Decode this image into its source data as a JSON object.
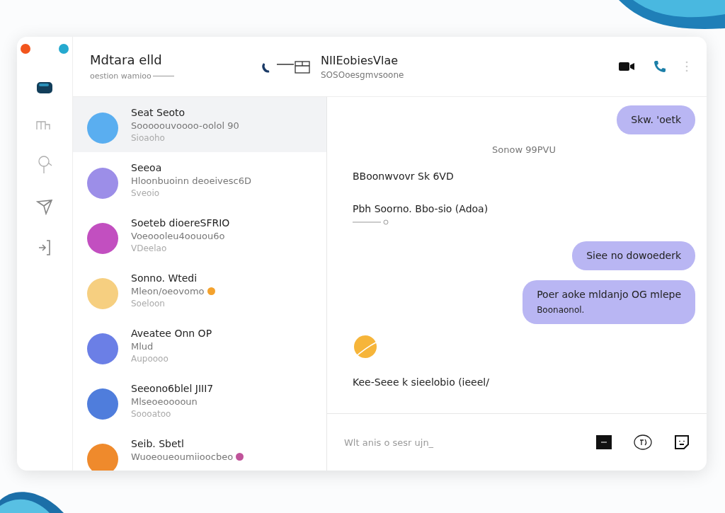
{
  "window": {
    "controls": [
      {
        "color": "#f2551d"
      },
      {
        "color": "#25a9cf"
      }
    ]
  },
  "rail": {
    "items": [
      {
        "selected": true
      },
      {
        "selected": false
      },
      {
        "selected": false
      },
      {
        "selected": false
      },
      {
        "selected": false
      }
    ]
  },
  "header": {
    "title": "Mdtara elld",
    "subtitle": "oestion wamioo",
    "contact_name": "NIIEobiesVlae",
    "contact_status": "SOSOoesgmvsoone"
  },
  "chats": [
    {
      "name": "Seat Seoto",
      "preview": "Sooooouvoooo-oolol 90",
      "time": "Sioaoho",
      "selected": true,
      "unread": false
    },
    {
      "name": "Seeoa",
      "preview": "Hloonbuoinn deoeivesc6D",
      "time": "Sveoio",
      "selected": false,
      "unread": false
    },
    {
      "name": "Soeteb dioereSFRIO",
      "preview": "Voeoooleu4oouou6o",
      "time": "VDeelao",
      "selected": false,
      "unread": false
    },
    {
      "name": "Sonno. Wtedi",
      "preview": "Mleon/oeovomo",
      "time": "Soeloon",
      "selected": false,
      "unread": true
    },
    {
      "name": "Aveatee Onn OP",
      "preview": "Mlud",
      "time": "Aupoooo",
      "selected": false,
      "unread": false
    },
    {
      "name": "Seeono6blel JIII7",
      "preview": "Mlseoeooooun",
      "time": "Soooatoo",
      "selected": false,
      "unread": false
    },
    {
      "name": "Seib. Sbetl",
      "preview": "Wuoeoueoumiioocbeo",
      "selected": false,
      "unread": true
    }
  ],
  "messages": [
    {
      "kind": "outgoing",
      "text": "Skw. 'oetk"
    },
    {
      "kind": "date",
      "text": "Sonow 99PVU"
    },
    {
      "kind": "incoming",
      "text": "BBoonwvovr Sk 6VD"
    },
    {
      "kind": "incoming",
      "text": "Pbh Soorno. Bbo-sio (Adoa)",
      "marker": true
    },
    {
      "kind": "outgoing",
      "text": "Siee no dowoederk"
    },
    {
      "kind": "outgoing",
      "text": "Poer aoke mldanjo OG mlepe",
      "second_line": "Boonaonol."
    },
    {
      "kind": "sticker"
    },
    {
      "kind": "incoming",
      "text": "Kee-Seee k sieelobio (ieeel/"
    }
  ],
  "composer": {
    "placeholder": "Wlt anis o sesr ujn_"
  }
}
